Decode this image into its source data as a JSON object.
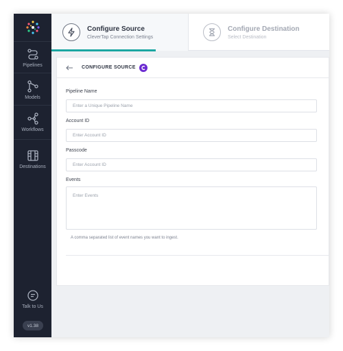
{
  "sidebar": {
    "items": [
      {
        "label": "Pipelines"
      },
      {
        "label": "Models"
      },
      {
        "label": "Workflows"
      },
      {
        "label": "Destinations"
      }
    ],
    "help": {
      "label": "Talk to Us"
    },
    "version": "v1.38"
  },
  "steps": [
    {
      "title": "Configure Source",
      "subtitle": "CleverTap Connection Settings",
      "state": "active"
    },
    {
      "title": "Configure Destination",
      "subtitle": "Select Destination",
      "state": "inactive"
    }
  ],
  "card": {
    "title": "CONFIGURE SOURCE",
    "source_badge": "C",
    "fields": {
      "pipeline_name": {
        "label": "Pipeline Name",
        "placeholder": "Enter a Unique Pipeline Name",
        "value": ""
      },
      "account_id": {
        "label": "Account ID",
        "placeholder": "Enter Account ID",
        "value": ""
      },
      "passcode": {
        "label": "Passcode",
        "placeholder": "Enter Account ID",
        "value": ""
      },
      "events": {
        "label": "Events",
        "placeholder": "Enter Events",
        "value": "",
        "hint": "A comma separated list of event names you want to ingest."
      }
    }
  },
  "colors": {
    "sidebar_bg": "#1d2230",
    "accent": "#1aa6a1",
    "source_badge": "#6b2bd1"
  }
}
